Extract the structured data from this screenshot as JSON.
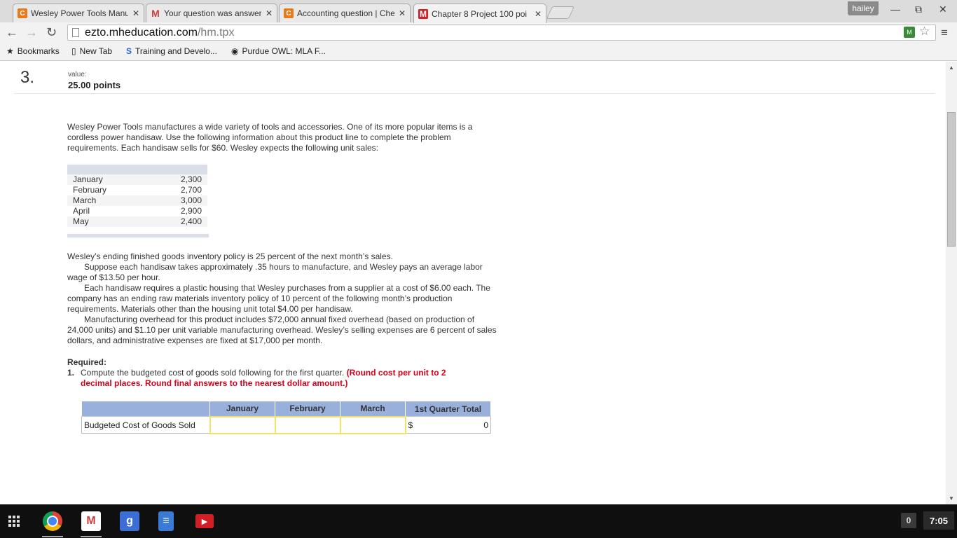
{
  "browser": {
    "tabs": [
      {
        "label": "Wesley Power Tools Manu",
        "favicon": "chegg-icon"
      },
      {
        "label": "Your question was answer",
        "favicon": "gmail-icon"
      },
      {
        "label": "Accounting question | Che",
        "favicon": "chegg-icon"
      },
      {
        "label": "Chapter 8 Project 100 poi",
        "favicon": "mheducation-icon"
      }
    ],
    "user": "hailey",
    "url_host": "ezto.mheducation.com",
    "url_path": "/hm.tpx",
    "bookmarks": [
      {
        "label": "Bookmarks",
        "icon": "star-icon"
      },
      {
        "label": "New Tab",
        "icon": "page-icon"
      },
      {
        "label": "Training and Develo...",
        "icon": "s-logo-icon"
      },
      {
        "label": "Purdue OWL: MLA F...",
        "icon": "owl-icon"
      }
    ]
  },
  "question": {
    "number": "3.",
    "value_label": "value:",
    "value_points": "25.00 points",
    "intro": "Wesley Power Tools manufactures a wide variety of tools and accessories. One of its more popular items is a cordless power handisaw. Use the following information about this product line to complete the problem requirements. Each handisaw sells for $60. Wesley expects the following unit sales:",
    "unit_sales": [
      {
        "month": "January",
        "units": "2,300"
      },
      {
        "month": "February",
        "units": "2,700"
      },
      {
        "month": "March",
        "units": "3,000"
      },
      {
        "month": "April",
        "units": "2,900"
      },
      {
        "month": "May",
        "units": "2,400"
      }
    ],
    "policy_1": "Wesley’s ending finished goods inventory policy is 25 percent of the next month’s sales.",
    "policy_2": "Suppose each handisaw takes approximately .35 hours to manufacture, and Wesley pays an average labor wage of $13.50 per hour.",
    "policy_3": "Each handisaw requires a plastic housing that Wesley purchases from a supplier at a cost of $6.00 each. The company has an ending raw materials inventory policy of 10 percent of the following month’s production requirements. Materials other than the housing unit total $4.00 per handisaw.",
    "policy_4": "Manufacturing overhead for this product includes $72,000 annual fixed overhead (based on production of 24,000 units) and $1.10 per unit variable manufacturing overhead. Wesley’s selling expenses are 6 percent of sales dollars, and administrative expenses are fixed at $17,000 per month.",
    "required_label": "Required:",
    "req1_num": "1.",
    "req1_text": "Compute the budgeted cost of goods sold following for the first quarter.",
    "req1_note_a": "(Round cost per unit to 2",
    "req1_note_b": "decimal places. Round final answers to the nearest dollar amount.)",
    "table": {
      "headers": [
        "",
        "January",
        "February",
        "March",
        "1st Quarter Total"
      ],
      "row_label": "Budgeted Cost of Goods Sold",
      "values": [
        "",
        "",
        ""
      ],
      "currency": "$",
      "total": "0"
    }
  },
  "shelf": {
    "apps": [
      "chrome-icon",
      "gmail-icon",
      "google-plus-icon",
      "docs-icon",
      "youtube-icon"
    ],
    "notification_count": "0",
    "time": "7:05"
  }
}
